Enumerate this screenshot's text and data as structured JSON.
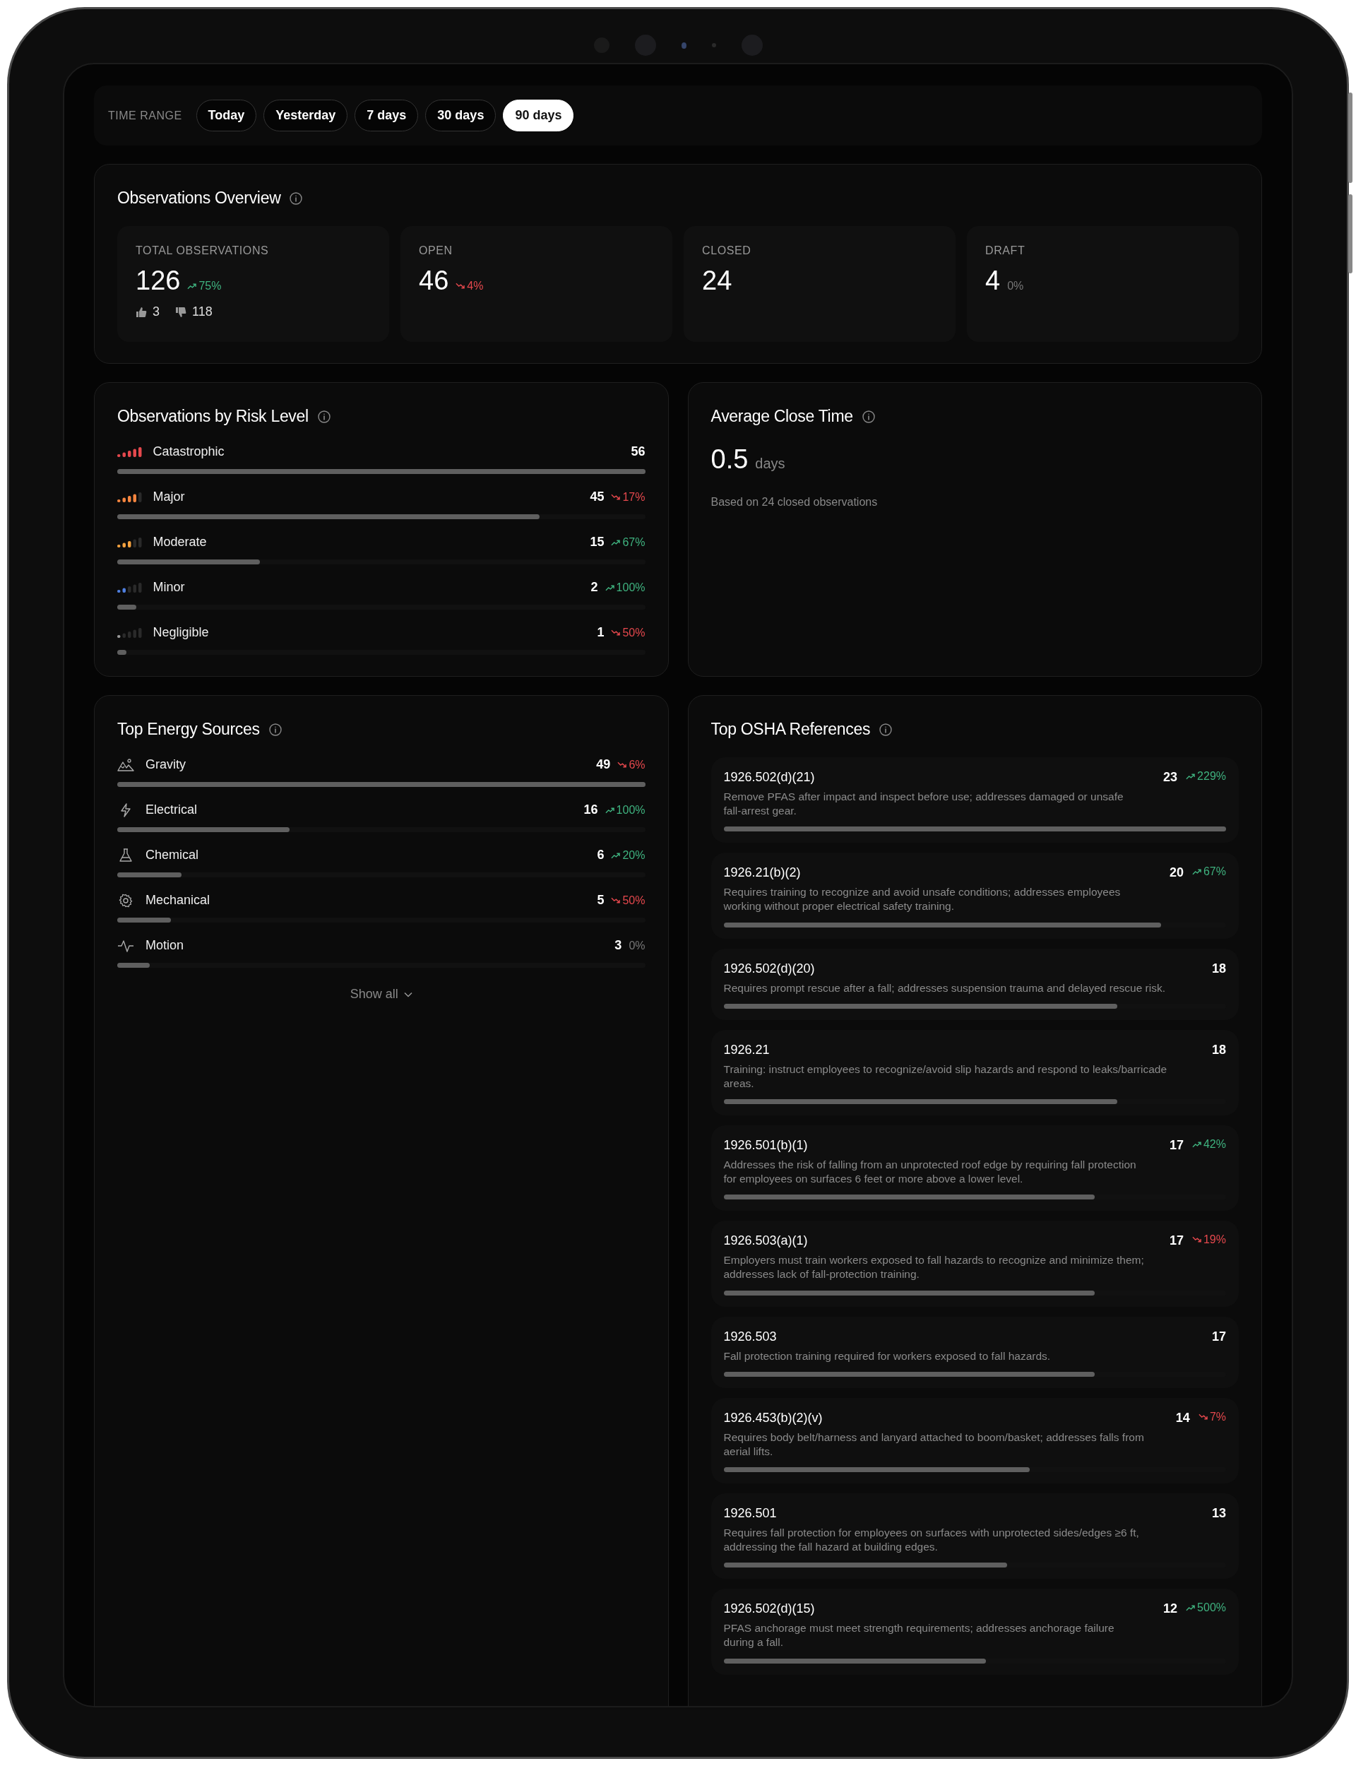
{
  "time_range": {
    "label": "TIME RANGE",
    "options": [
      {
        "label": "Today",
        "selected": false
      },
      {
        "label": "Yesterday",
        "selected": false
      },
      {
        "label": "7 days",
        "selected": false
      },
      {
        "label": "30 days",
        "selected": false
      },
      {
        "label": "90 days",
        "selected": true
      }
    ]
  },
  "overview": {
    "title": "Observations Overview",
    "stats": [
      {
        "label": "TOTAL OBSERVATIONS",
        "value": "126",
        "trend": {
          "text": "75%",
          "kind": "up"
        },
        "thumbs_up": "3",
        "thumbs_down": "118"
      },
      {
        "label": "OPEN",
        "value": "46",
        "trend": {
          "text": "4%",
          "kind": "down"
        }
      },
      {
        "label": "CLOSED",
        "value": "24"
      },
      {
        "label": "DRAFT",
        "value": "4",
        "trend": {
          "text": "0%",
          "kind": "flat"
        }
      }
    ]
  },
  "risk_levels": {
    "title": "Observations by Risk Level",
    "items": [
      {
        "name": "Catastrophic",
        "count": "56",
        "level": 1.0,
        "meter": {
          "level": 1.0,
          "color": "#e5484d"
        }
      },
      {
        "name": "Major",
        "count": "45",
        "level": 0.8,
        "trend": {
          "text": "17%",
          "kind": "down"
        },
        "meter": {
          "level": 0.8,
          "color": "#f5853f"
        }
      },
      {
        "name": "Moderate",
        "count": "15",
        "level": 0.27,
        "trend": {
          "text": "67%",
          "kind": "up"
        },
        "meter": {
          "level": 0.6,
          "color": "#f5a23f"
        }
      },
      {
        "name": "Minor",
        "count": "2",
        "level": 0.036,
        "trend": {
          "text": "100%",
          "kind": "up"
        },
        "meter": {
          "level": 0.4,
          "color": "#4f7fe0"
        }
      },
      {
        "name": "Negligible",
        "count": "1",
        "level": 0.018,
        "trend": {
          "text": "50%",
          "kind": "down"
        },
        "meter": {
          "level": 0.2,
          "color": "#9a9a9a"
        }
      }
    ]
  },
  "average_close_time": {
    "title": "Average Close Time",
    "value": "0.5",
    "unit": "days",
    "note": "Based on 24 closed observations"
  },
  "energy_sources": {
    "title": "Top Energy Sources",
    "items": [
      {
        "kind": "gravity",
        "name": "Gravity",
        "count": "49",
        "level": 1.0,
        "trend": {
          "text": "6%",
          "kind": "down"
        }
      },
      {
        "kind": "electrical",
        "name": "Electrical",
        "count": "16",
        "level": 0.327,
        "trend": {
          "text": "100%",
          "kind": "up"
        }
      },
      {
        "kind": "chemical",
        "name": "Chemical",
        "count": "6",
        "level": 0.122,
        "trend": {
          "text": "20%",
          "kind": "up"
        }
      },
      {
        "kind": "mechanical",
        "name": "Mechanical",
        "count": "5",
        "level": 0.102,
        "trend": {
          "text": "50%",
          "kind": "down"
        }
      },
      {
        "kind": "motion",
        "name": "Motion",
        "count": "3",
        "level": 0.061,
        "trend": {
          "text": "0%",
          "kind": "flat"
        }
      }
    ],
    "show_all": "Show all"
  },
  "osha_references": {
    "title": "Top OSHA References",
    "items": [
      {
        "code": "1926.502(d)(21)",
        "description": "Remove PFAS after impact and inspect before use; addresses damaged or unsafe fall-arrest gear.",
        "count": "23",
        "level": 1.0,
        "trend": {
          "text": "229%",
          "kind": "up"
        }
      },
      {
        "code": "1926.21(b)(2)",
        "description": "Requires training to recognize and avoid unsafe conditions; addresses employees working without proper electrical safety training.",
        "count": "20",
        "level": 0.87,
        "trend": {
          "text": "67%",
          "kind": "up"
        }
      },
      {
        "code": "1926.502(d)(20)",
        "description": "Requires prompt rescue after a fall; addresses suspension trauma and delayed rescue risk.",
        "count": "18",
        "level": 0.783
      },
      {
        "code": "1926.21",
        "description": "Training: instruct employees to recognize/avoid slip hazards and respond to leaks/barricade areas.",
        "count": "18",
        "level": 0.783
      },
      {
        "code": "1926.501(b)(1)",
        "description": "Addresses the risk of falling from an unprotected roof edge by requiring fall protection for employees on surfaces 6 feet or more above a lower level.",
        "count": "17",
        "level": 0.739,
        "trend": {
          "text": "42%",
          "kind": "up"
        }
      },
      {
        "code": "1926.503(a)(1)",
        "description": "Employers must train workers exposed to fall hazards to recognize and minimize them; addresses lack of fall-protection training.",
        "count": "17",
        "level": 0.739,
        "trend": {
          "text": "19%",
          "kind": "down"
        }
      },
      {
        "code": "1926.503",
        "description": "Fall protection training required for workers exposed to fall hazards.",
        "count": "17",
        "level": 0.739
      },
      {
        "code": "1926.453(b)(2)(v)",
        "description": "Requires body belt/harness and lanyard attached to boom/basket; addresses falls from aerial lifts.",
        "count": "14",
        "level": 0.609,
        "trend": {
          "text": "7%",
          "kind": "down"
        }
      },
      {
        "code": "1926.501",
        "description": "Requires fall protection for employees on surfaces with unprotected sides/edges ≥6 ft, addressing the fall hazard at building edges.",
        "count": "13",
        "level": 0.565
      },
      {
        "code": "1926.502(d)(15)",
        "description": "PFAS anchorage must meet strength requirements; addresses anchorage failure during a fall.",
        "count": "12",
        "level": 0.522,
        "trend": {
          "text": "500%",
          "kind": "up"
        }
      }
    ]
  }
}
